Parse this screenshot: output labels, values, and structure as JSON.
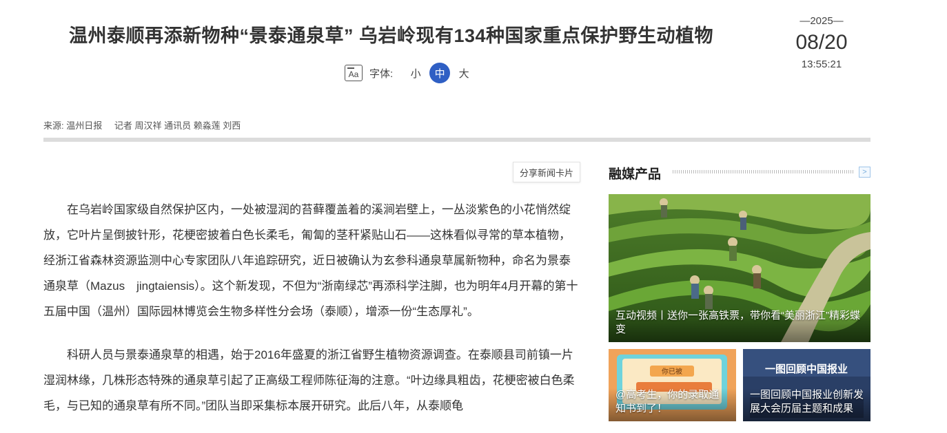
{
  "article": {
    "title": "温州泰顺再添新物种“景泰通泉草” 乌岩岭现有134种国家重点保护野生动植物",
    "font_control": {
      "label": "字体:",
      "options": [
        "小",
        "中",
        "大"
      ],
      "selected": "中"
    },
    "date": {
      "year": "—2025—",
      "month_day": "08/20",
      "time": "13:55:21"
    },
    "source": {
      "label": "来源: 温州日报",
      "authors": "记者 周汉祥 通讯员 赖淼莲 刘西"
    },
    "share_label": "分享新闻卡片",
    "paragraphs": [
      "在乌岩岭国家级自然保护区内，一处被湿润的苔藓覆盖着的溪涧岩壁上，一丛淡紫色的小花悄然绽放，它叶片呈倒披针形，花梗密披着白色长柔毛，匍匐的茎秆紧贴山石——这株看似寻常的草本植物，经浙江省森林资源监测中心专家团队八年追踪研究，近日被确认为玄参科通泉草属新物种，命名为景泰通泉草（Mazus　jingtaiensis）。这个新发现，不但为“浙南绿芯”再添科学注脚，也为明年4月开幕的第十五届中国（温州）国际园林博览会生物多样性分会场（泰顺），增添一份“生态厚礼”。",
      "科研人员与景泰通泉草的相遇，始于2016年盛夏的浙江省野生植物资源调查。在泰顺县司前镇一片湿润林缘，几株形态特殊的通泉草引起了正高级工程师陈征海的注意。“叶边缘具粗齿，花梗密被白色柔毛，与已知的通泉草有所不同。”团队当即采集标本展开研究。此后八年，从泰顺龟"
    ]
  },
  "sidebar": {
    "title": "融媒产品",
    "more_icon": ">",
    "cards": [
      {
        "caption": "互动视频丨送你一张高铁票，带你看“美丽浙江”精彩蝶变"
      },
      {
        "caption": "@高考生，你的录取通知书到了！",
        "image_text": "你已被"
      },
      {
        "caption": "一图回顾中国报业创新发展大会历届主题和成果",
        "image_text": "一图回顾中国报业"
      }
    ]
  },
  "colors": {
    "accent": "#2f5fc4",
    "divider": "#dcdcdc",
    "text": "#333333"
  }
}
